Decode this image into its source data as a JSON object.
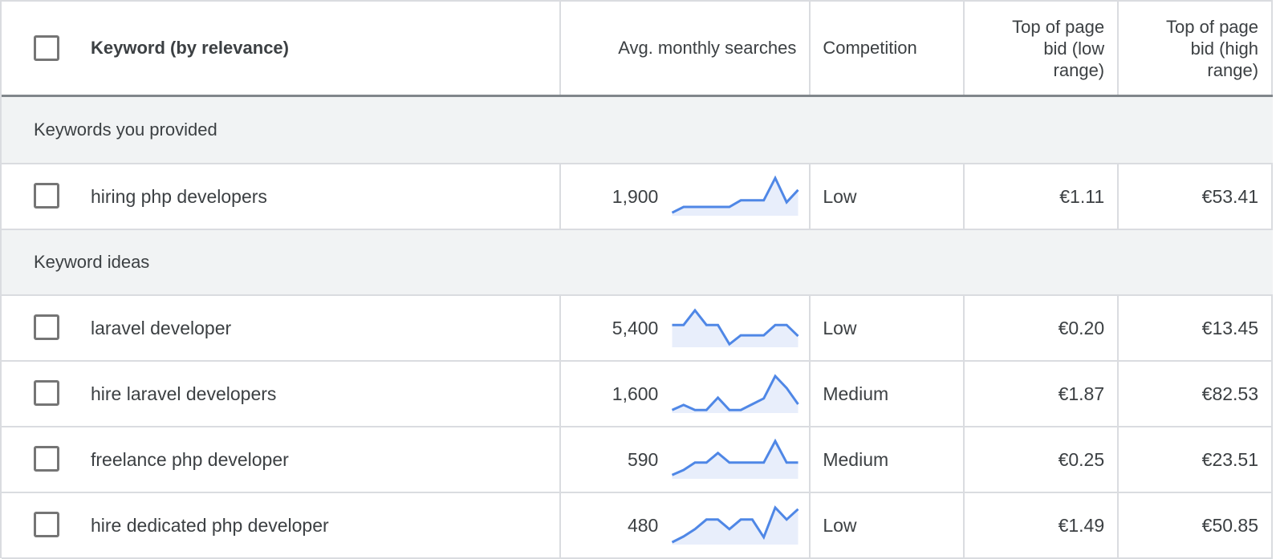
{
  "header": {
    "select_all_checked": false,
    "keyword_col": "Keyword (by relevance)",
    "avg_col": "Avg. monthly searches",
    "competition_col": "Competition",
    "low_bid_col": "Top of page bid (low range)",
    "high_bid_col": "Top of page bid (high range)"
  },
  "colors": {
    "sparkline_line": "#4f87e6",
    "sparkline_fill": "#e8eefb",
    "group_bg": "#f1f3f4"
  },
  "groups": [
    {
      "label": "Keywords you provided",
      "rows": [
        {
          "keyword": "hiring php developers",
          "checked": false,
          "avg_monthly_searches": "1,900",
          "trend_relative": [
            8,
            23,
            23,
            23,
            23,
            23,
            40,
            40,
            40,
            98,
            35,
            67
          ],
          "competition": "Low",
          "low_bid": "€1.11",
          "high_bid": "€53.41"
        }
      ]
    },
    {
      "label": "Keyword ideas",
      "rows": [
        {
          "keyword": "laravel developer",
          "checked": false,
          "avg_monthly_searches": "5,400",
          "trend_relative": [
            58,
            58,
            96,
            58,
            58,
            8,
            31,
            31,
            31,
            58,
            58,
            29
          ],
          "competition": "Low",
          "low_bid": "€0.20",
          "high_bid": "€13.45"
        },
        {
          "keyword": "hire laravel developers",
          "checked": false,
          "avg_monthly_searches": "1,600",
          "trend_relative": [
            8,
            21,
            8,
            8,
            40,
            8,
            8,
            23,
            38,
            96,
            65,
            23
          ],
          "competition": "Medium",
          "low_bid": "€1.87",
          "high_bid": "€82.53"
        },
        {
          "keyword": "freelance php developer",
          "checked": false,
          "avg_monthly_searches": "590",
          "trend_relative": [
            10,
            23,
            42,
            42,
            67,
            42,
            42,
            42,
            42,
            98,
            42,
            42
          ],
          "competition": "Medium",
          "low_bid": "€0.25",
          "high_bid": "€23.51"
        },
        {
          "keyword": "hire dedicated php developer",
          "checked": false,
          "avg_monthly_searches": "480",
          "trend_relative": [
            6,
            21,
            40,
            65,
            65,
            40,
            65,
            65,
            19,
            96,
            65,
            92
          ],
          "competition": "Low",
          "low_bid": "€1.49",
          "high_bid": "€50.85"
        }
      ]
    }
  ]
}
